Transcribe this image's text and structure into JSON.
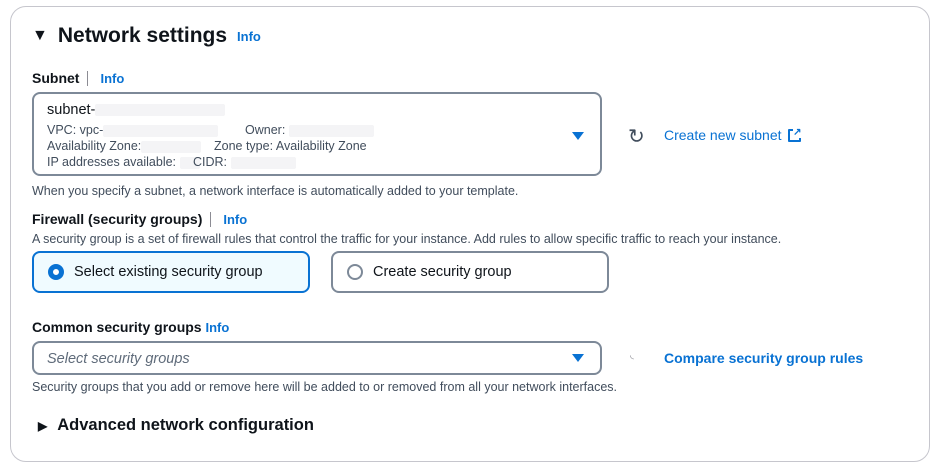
{
  "section": {
    "title": "Network settings",
    "info": "Info"
  },
  "subnet": {
    "label": "Subnet",
    "info": "Info",
    "value": "subnet-",
    "vpc": "VPC: vpc-",
    "owner": "Owner:",
    "az": "Availability Zone:",
    "zone_type": "Zone type: Availability Zone",
    "ip": "IP addresses available:",
    "cidr": "CIDR:",
    "create_link": "Create new subnet",
    "help": "When you specify a subnet, a network interface is automatically added to your template."
  },
  "firewall": {
    "label": "Firewall (security groups)",
    "info": "Info",
    "desc": "A security group is a set of firewall rules that control the traffic for your instance. Add rules to allow specific traffic to reach your instance.",
    "options": [
      {
        "label": "Select existing security group",
        "selected": true
      },
      {
        "label": "Create security group",
        "selected": false
      }
    ]
  },
  "common": {
    "label": "Common security groups",
    "info": "Info",
    "placeholder": "Select security groups",
    "compare_link": "Compare security group rules",
    "help": "Security groups that you add or remove here will be added to or removed from all your network interfaces."
  },
  "advanced": {
    "label": "Advanced network configuration"
  },
  "colors": {
    "accent": "#0972d3"
  }
}
